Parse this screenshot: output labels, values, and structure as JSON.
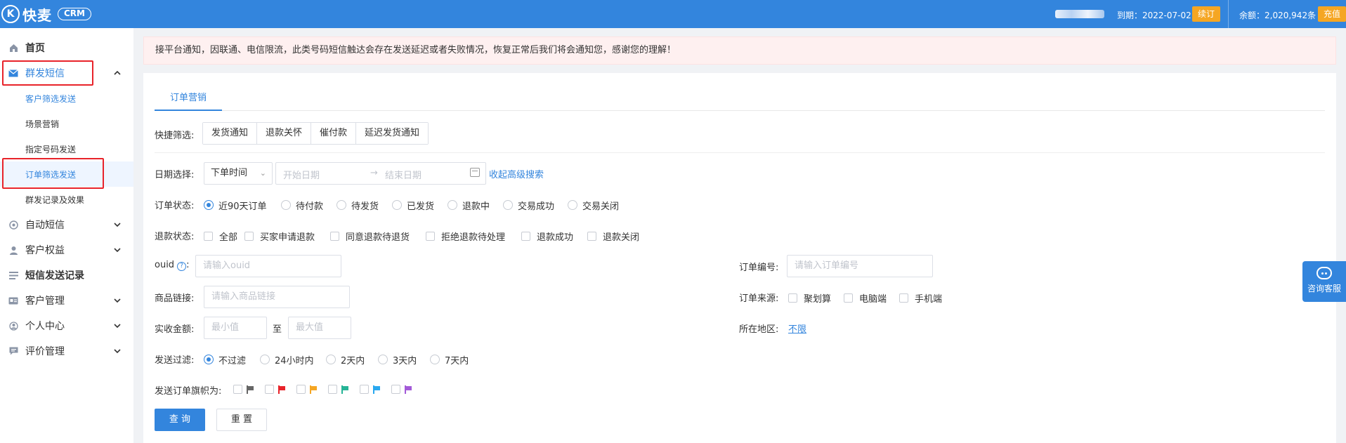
{
  "header": {
    "logo_mark": "K",
    "logo_text": "快麦",
    "crm_badge": "CRM",
    "expire_text": "到期：2022-07-02",
    "renew_label": "续订",
    "balance_text": "余额：2,020,942条",
    "recharge_label": "充值"
  },
  "sidebar": {
    "items": [
      {
        "label": "首页",
        "icon": "home-icon"
      },
      {
        "label": "群发短信",
        "icon": "mail-icon"
      },
      {
        "label": "自动短信",
        "icon": "auto-icon"
      },
      {
        "label": "客户权益",
        "icon": "user-icon"
      },
      {
        "label": "短信发送记录",
        "icon": "record-icon"
      },
      {
        "label": "客户管理",
        "icon": "card-icon"
      },
      {
        "label": "个人中心",
        "icon": "person-icon"
      },
      {
        "label": "评价管理",
        "icon": "comment-icon"
      }
    ],
    "sub_items": [
      "客户筛选发送",
      "场景营销",
      "指定号码发送",
      "订单筛选发送",
      "群发记录及效果"
    ],
    "selected_sub": "订单筛选发送"
  },
  "notice": "接平台通知，因联通、电信限流，此类号码短信触达会存在发送延迟或者失败情况，恢复正常后我们将会通知您，感谢您的理解！",
  "tabs": [
    {
      "label": "订单营销"
    }
  ],
  "form": {
    "quick_filter": {
      "label": "快捷筛选:",
      "options": [
        "发货通知",
        "退款关怀",
        "催付款",
        "延迟发货通知"
      ]
    },
    "date": {
      "label": "日期选择:",
      "type_value": "下单时间",
      "start_placeholder": "开始日期",
      "separator": "→",
      "end_placeholder": "结束日期",
      "collapse_link": "收起高级搜索"
    },
    "order_status": {
      "label": "订单状态:",
      "options": [
        "近90天订单",
        "待付款",
        "待发货",
        "已发货",
        "退款中",
        "交易成功",
        "交易关闭"
      ],
      "selected": "近90天订单"
    },
    "refund_status": {
      "label": "退款状态:",
      "options": [
        "全部",
        "买家申请退款",
        "同意退款待退货",
        "拒绝退款待处理",
        "退款成功",
        "退款关闭"
      ]
    },
    "ouid": {
      "label": "ouid",
      "colon": ":",
      "placeholder": "请输入ouid"
    },
    "order_no": {
      "label": "订单编号:",
      "placeholder": "请输入订单编号"
    },
    "product_link": {
      "label": "商品链接:",
      "placeholder": "请输入商品链接"
    },
    "order_source": {
      "label": "订单来源:",
      "options": [
        "聚划算",
        "电脑端",
        "手机端"
      ]
    },
    "amount": {
      "label": "实收金额:",
      "min_placeholder": "最小值",
      "to": "至",
      "max_placeholder": "最大值"
    },
    "region": {
      "label": "所在地区:",
      "value": "不限"
    },
    "send_filter": {
      "label": "发送过滤:",
      "options": [
        "不过滤",
        "24小时内",
        "2天内",
        "3天内",
        "7天内"
      ],
      "selected": "不过滤"
    },
    "flags": {
      "label": "发送订单旗帜为:",
      "colors": [
        "#666666",
        "#e8232a",
        "#f5a623",
        "#26b496",
        "#29a8ef",
        "#a35ad8"
      ]
    },
    "query_label": "查 询",
    "reset_label": "重 置"
  },
  "float_help": {
    "label": "咨询客服"
  }
}
